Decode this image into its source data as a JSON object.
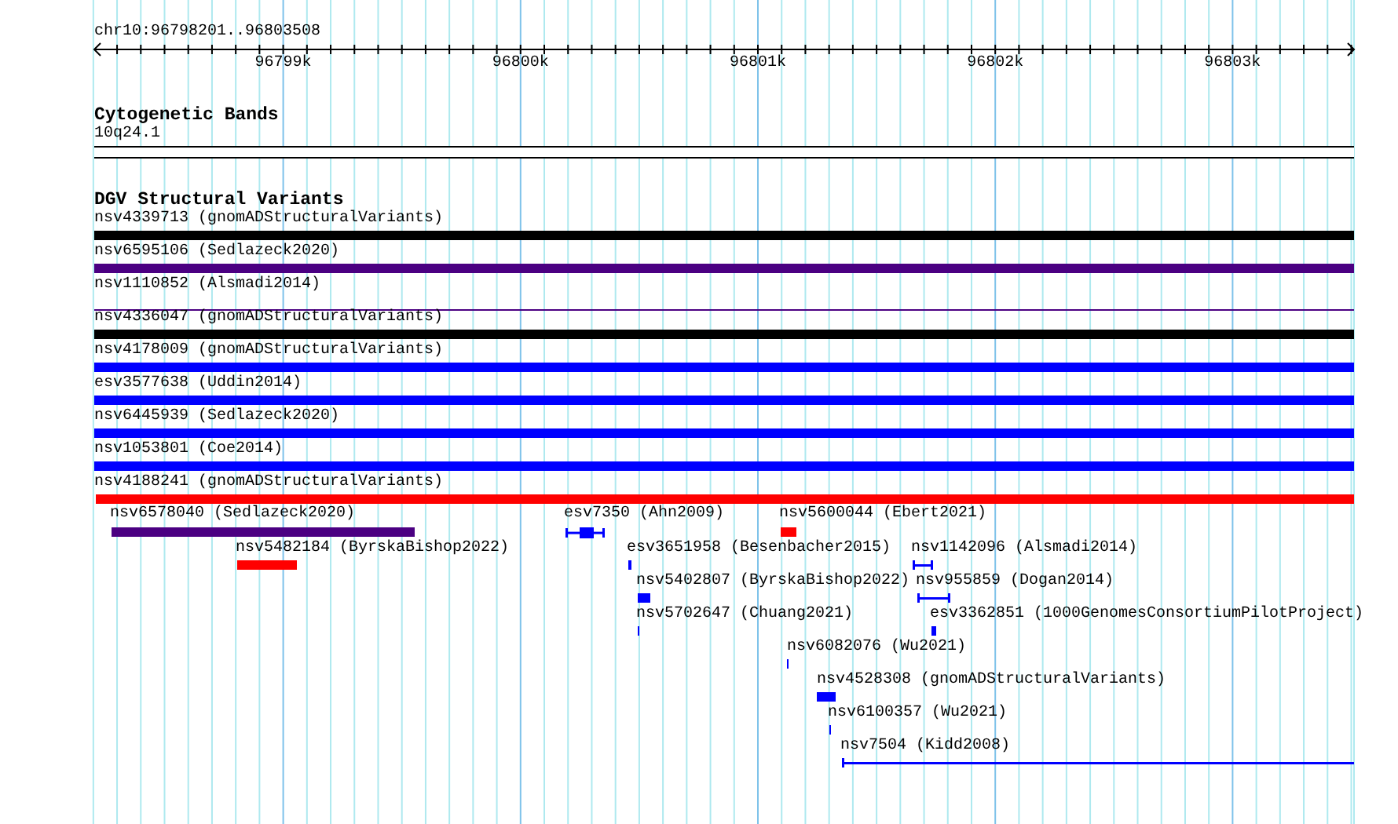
{
  "location": "chr10:96798201..96803508",
  "ruler": {
    "ticks": [
      "96799k",
      "96800k",
      "96801k",
      "96802k",
      "96803k"
    ]
  },
  "cytogenetic_bands": {
    "title": "Cytogenetic Bands",
    "band": "10q24.1"
  },
  "dgv_structural_variants": {
    "title": "DGV Structural Variants",
    "features": [
      {
        "label": "nsv4339713 (gnomADStructuralVariants)",
        "kind": "bar",
        "color": "#000000"
      },
      {
        "label": "nsv6595106 (Sedlazeck2020)",
        "kind": "bar",
        "color": "#4b0082"
      },
      {
        "label": "nsv1110852 (Alsmadi2014)",
        "kind": "line",
        "color": "#4b0082"
      },
      {
        "label": "nsv4336047 (gnomADStructuralVariants)",
        "kind": "bar",
        "color": "#000000"
      },
      {
        "label": "nsv4178009 (gnomADStructuralVariants)",
        "kind": "bar",
        "color": "#0000ff"
      },
      {
        "label": "esv3577638 (Uddin2014)",
        "kind": "bar",
        "color": "#0000ff"
      },
      {
        "label": "nsv6445939 (Sedlazeck2020)",
        "kind": "bar",
        "color": "#0000ff"
      },
      {
        "label": "nsv1053801 (Coe2014)",
        "kind": "bar",
        "color": "#0000ff"
      },
      {
        "label": "nsv4188241 (gnomADStructuralVariants)",
        "kind": "bar",
        "color": "#ff0000"
      },
      {
        "label": "nsv6578040 (Sedlazeck2020)",
        "kind": "bar",
        "color": "#4b0082"
      },
      {
        "label": "esv7350 (Ahn2009)",
        "kind": "compound",
        "color": "#0000ff"
      },
      {
        "label": "nsv5600044 (Ebert2021)",
        "kind": "bar",
        "color": "#ff0000"
      },
      {
        "label": "nsv5482184 (ByrskaBishop2022)",
        "kind": "bar",
        "color": "#ff0000"
      },
      {
        "label": "esv3651958 (Besenbacher2015)",
        "kind": "bar",
        "color": "#0000ff"
      },
      {
        "label": "nsv1142096 (Alsmadi2014)",
        "kind": "span",
        "color": "#0000ff"
      },
      {
        "label": "nsv5402807 (ByrskaBishop2022)",
        "kind": "bar",
        "color": "#0000ff"
      },
      {
        "label": "nsv955859 (Dogan2014)",
        "kind": "span",
        "color": "#0000ff"
      },
      {
        "label": "nsv5702647 (Chuang2021)",
        "kind": "bar",
        "color": "#0000ff"
      },
      {
        "label": "esv3362851 (1000GenomesConsortiumPilotProject)",
        "kind": "bar",
        "color": "#0000ff"
      },
      {
        "label": "nsv6082076 (Wu2021)",
        "kind": "bar",
        "color": "#0000ff"
      },
      {
        "label": "nsv4528308 (gnomADStructuralVariants)",
        "kind": "bar",
        "color": "#0000ff"
      },
      {
        "label": "nsv6100357 (Wu2021)",
        "kind": "bar",
        "color": "#0000ff"
      },
      {
        "label": "nsv7504 (Kidd2008)",
        "kind": "span",
        "color": "#0000ff"
      }
    ]
  }
}
